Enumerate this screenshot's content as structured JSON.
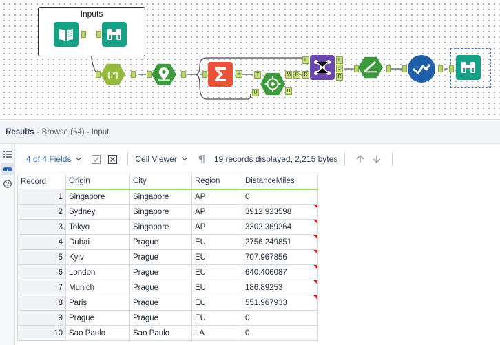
{
  "canvas": {
    "container_title": "Inputs",
    "anchor_labels": {
      "summ_t": "T",
      "summ_m": "M",
      "summ_r": "R",
      "summ_u": "U",
      "spatial_u": "U",
      "join_l": "L",
      "join_r": "R",
      "join_lo": "L",
      "join_j": "J",
      "join_ro": "R"
    }
  },
  "results": {
    "title": "Results",
    "subtitle": "- Browse (64) - Input"
  },
  "toolbar": {
    "fields_label": "4 of 4 Fields",
    "viewer_label": "Cell Viewer",
    "records_info": "19 records displayed, 2,215 bytes"
  },
  "grid": {
    "columns": [
      "Record",
      "Origin",
      "City",
      "Region",
      "DistanceMiles"
    ],
    "rows": [
      {
        "record": "1",
        "origin": "Singapore",
        "city": "Singapore",
        "region": "AP",
        "distance": "0",
        "flag": false
      },
      {
        "record": "2",
        "origin": "Sydney",
        "city": "Singapore",
        "region": "AP",
        "distance": "3912.923598",
        "flag": true
      },
      {
        "record": "3",
        "origin": "Tokyo",
        "city": "Singapore",
        "region": "AP",
        "distance": "3302.369264",
        "flag": true
      },
      {
        "record": "4",
        "origin": "Dubai",
        "city": "Prague",
        "region": "EU",
        "distance": "2756.249851",
        "flag": true
      },
      {
        "record": "5",
        "origin": "Kyiv",
        "city": "Prague",
        "region": "EU",
        "distance": "707.967856",
        "flag": true
      },
      {
        "record": "6",
        "origin": "London",
        "city": "Prague",
        "region": "EU",
        "distance": "640.406087",
        "flag": true
      },
      {
        "record": "7",
        "origin": "Munich",
        "city": "Prague",
        "region": "EU",
        "distance": "186.89253",
        "flag": true
      },
      {
        "record": "8",
        "origin": "Paris",
        "city": "Prague",
        "region": "EU",
        "distance": "551.967933",
        "flag": true
      },
      {
        "record": "9",
        "origin": "Prague",
        "city": "Prague",
        "region": "EU",
        "distance": "0",
        "flag": false
      },
      {
        "record": "10",
        "origin": "Sao Paulo",
        "city": "Sao Paulo",
        "region": "LA",
        "distance": "0",
        "flag": false
      }
    ]
  },
  "icons": {
    "input_tool": "book-input-icon",
    "browse_tool": "binoculars-icon",
    "regex_tool": "regex-icon",
    "spatial_tool": "map-pin-icon",
    "summarize_tool": "sigma-icon",
    "spatial_match_tool": "target-icon",
    "join_tool": "join-icon",
    "filter_tool": "ruler-icon",
    "select_tool": "check-icon",
    "rail_list": "list-icon",
    "rail_browse": "binoculars-icon",
    "rail_help": "help-icon",
    "tb_checkbox": "checkbox-icon",
    "tb_close": "close-box-icon",
    "tb_para": "pilcrow-icon",
    "tb_up": "arrow-up-icon",
    "tb_down": "arrow-down-icon"
  },
  "colors": {
    "teal": "#16a085",
    "olive": "#95b93a",
    "orange": "#e8533a",
    "purple": "#6a47a8",
    "navy": "#1f5ea8",
    "anchor": "#b8d86a",
    "link_blue": "#2c65b3",
    "flag_red": "#d6202a"
  }
}
